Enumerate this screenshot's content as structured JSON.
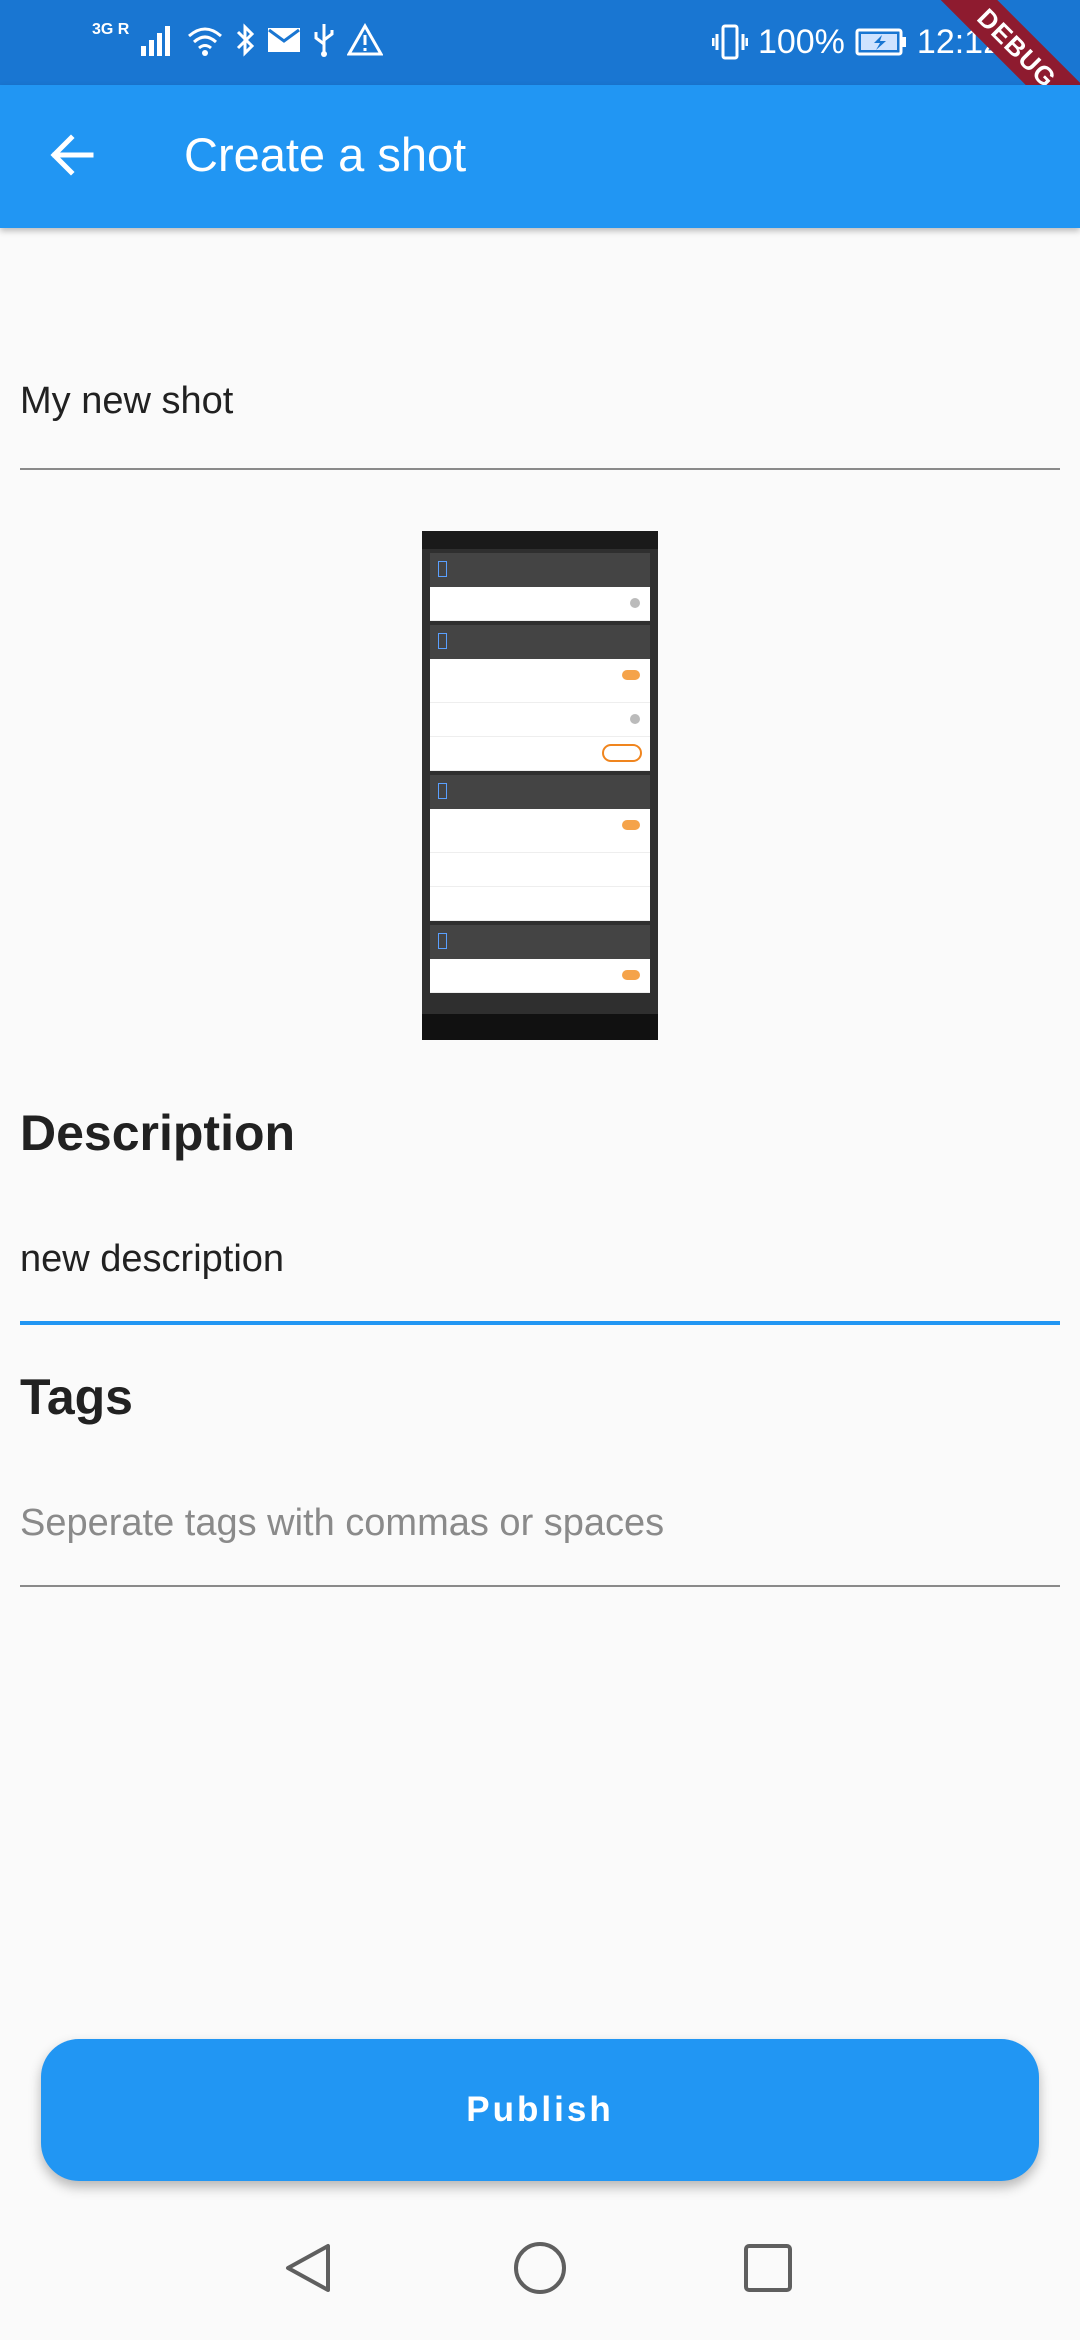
{
  "status_bar": {
    "network_label": "3G R",
    "battery": "100%",
    "time": "12:12",
    "debug_banner": "DEBUG",
    "icons": [
      "signal-icon",
      "wifi-icon",
      "bluetooth-icon",
      "mail-icon",
      "usb-icon",
      "warning-icon",
      "vibrate-icon",
      "battery-charging-icon"
    ]
  },
  "app_bar": {
    "title": "Create a shot",
    "back_icon": "arrow-left-icon"
  },
  "form": {
    "title_value": "My new shot",
    "description_heading": "Description",
    "description_value": "new description",
    "tags_heading": "Tags",
    "tags_placeholder": "Seperate tags with commas or spaces"
  },
  "actions": {
    "publish_label": "Publish"
  },
  "nav": {
    "icons": [
      "nav-back-icon",
      "nav-home-icon",
      "nav-recents-icon"
    ]
  },
  "colors": {
    "primary": "#2196f3",
    "status_bar": "#1976d2",
    "background": "#fafafa"
  }
}
